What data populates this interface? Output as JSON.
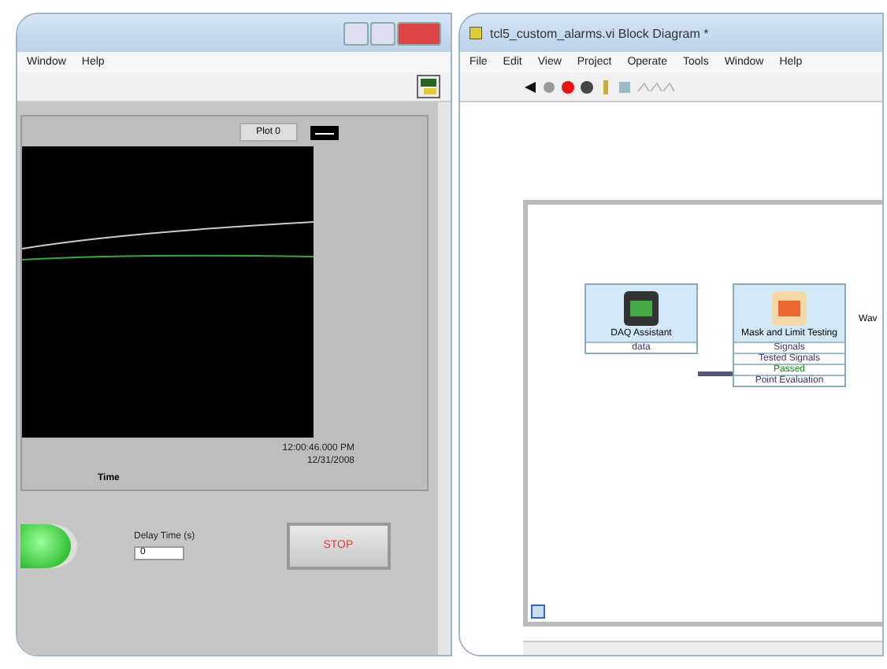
{
  "front_panel": {
    "menu": [
      "Window",
      "Help"
    ],
    "legend": "Plot 0",
    "graph_time_stamp": [
      "12:00:46.000 PM",
      "12/31/2008"
    ],
    "x_axis_label": "Time",
    "led": {
      "on": true
    },
    "delay": {
      "label": "Delay Time (s)",
      "value": "0"
    },
    "stop_button": "STOP"
  },
  "block_diagram": {
    "window_title": "tcl5_custom_alarms.vi Block Diagram *",
    "menu": [
      "File",
      "Edit",
      "View",
      "Project",
      "Operate",
      "Tools",
      "Window",
      "Help"
    ],
    "nodes": [
      {
        "title": "DAQ Assistant",
        "terminals": [
          {
            "label": "data",
            "kind": "plain"
          }
        ]
      },
      {
        "title": "Mask and Limit Testing",
        "terminals": [
          {
            "label": "Signals",
            "kind": "plain"
          },
          {
            "label": "Tested Signals",
            "kind": "plain"
          },
          {
            "label": "Passed",
            "kind": "bool"
          },
          {
            "label": "Point Evaluation",
            "kind": "plain"
          }
        ]
      }
    ],
    "cut_label": "Wav"
  }
}
